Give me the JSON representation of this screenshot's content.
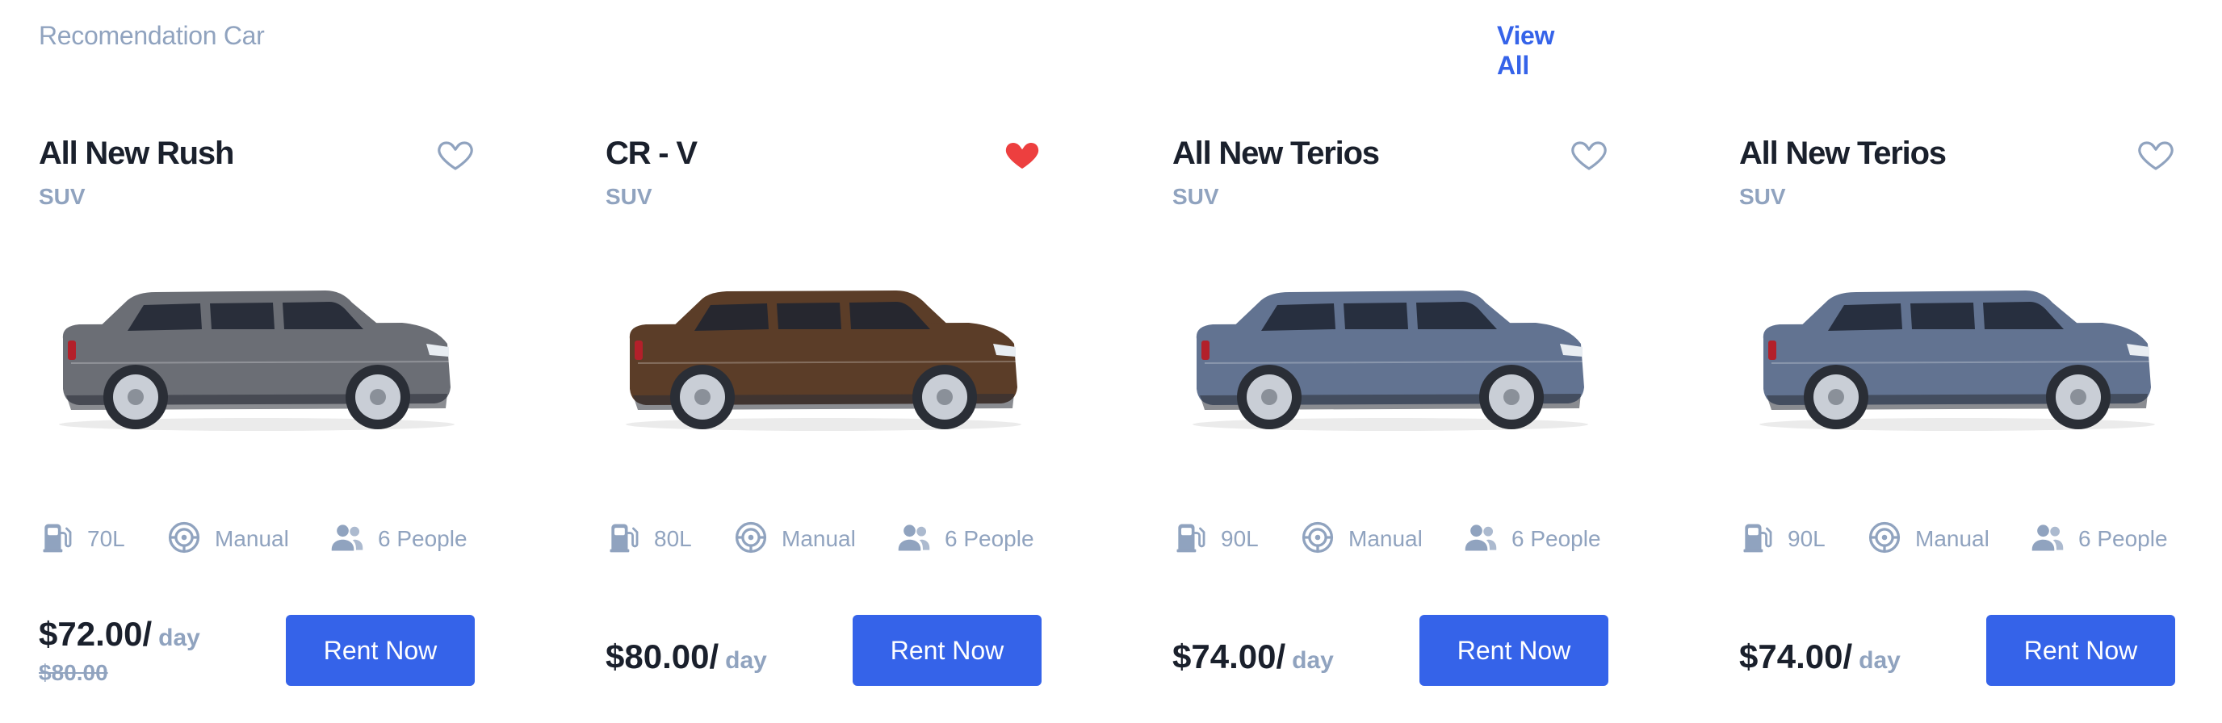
{
  "section": {
    "title": "Recomendation Car",
    "view_all": "View All"
  },
  "colors": {
    "accent": "#3563e9",
    "muted": "#90a3bf",
    "heading": "#1a202c",
    "favorite_active": "#ed3f3f"
  },
  "cards": [
    {
      "name": "All New Rush",
      "type": "SUV",
      "favorite": false,
      "car_color": "#6b6e75",
      "fuel": "70L",
      "transmission": "Manual",
      "capacity": "6 People",
      "price": "$72.00/",
      "per": "day",
      "old_price": "$80.00",
      "button": "Rent Now",
      "icons": [
        "heart-outline-icon",
        "gas-station-icon",
        "steering-wheel-icon",
        "people-icon"
      ]
    },
    {
      "name": "CR  - V",
      "type": "SUV",
      "favorite": true,
      "car_color": "#5b3d28",
      "fuel": "80L",
      "transmission": "Manual",
      "capacity": "6 People",
      "price": "$80.00/",
      "per": "day",
      "old_price": "",
      "button": "Rent Now",
      "icons": [
        "heart-filled-icon",
        "gas-station-icon",
        "steering-wheel-icon",
        "people-icon"
      ]
    },
    {
      "name": "All New Terios",
      "type": "SUV",
      "favorite": false,
      "car_color": "#627391",
      "fuel": "90L",
      "transmission": "Manual",
      "capacity": "6 People",
      "price": "$74.00/",
      "per": "day",
      "old_price": "",
      "button": "Rent Now",
      "icons": [
        "heart-outline-icon",
        "gas-station-icon",
        "steering-wheel-icon",
        "people-icon"
      ]
    },
    {
      "name": "All New Terios",
      "type": "SUV",
      "favorite": false,
      "car_color": "#627391",
      "fuel": "90L",
      "transmission": "Manual",
      "capacity": "6 People",
      "price": "$74.00/",
      "per": "day",
      "old_price": "",
      "button": "Rent Now",
      "icons": [
        "heart-outline-icon",
        "gas-station-icon",
        "steering-wheel-icon",
        "people-icon"
      ]
    }
  ]
}
